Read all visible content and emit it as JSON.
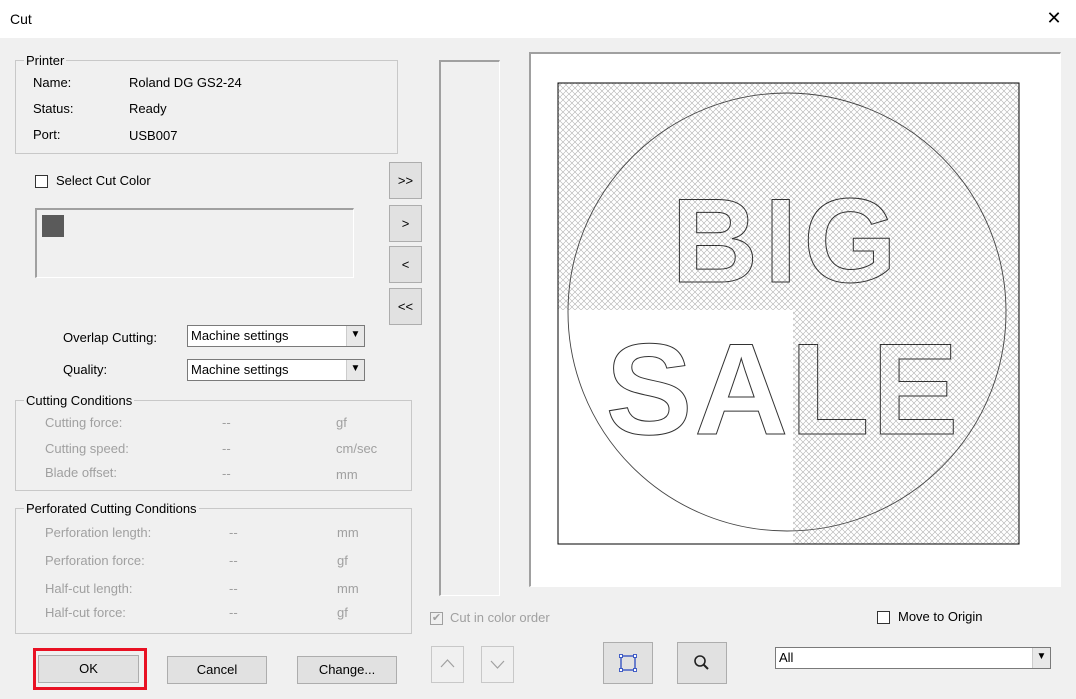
{
  "window": {
    "title": "Cut",
    "close": "✕"
  },
  "printer": {
    "legend": "Printer",
    "name_label": "Name:",
    "name_value": "Roland DG GS2-24",
    "status_label": "Status:",
    "status_value": "Ready",
    "port_label": "Port:",
    "port_value": "USB007"
  },
  "select_cut_color": {
    "label": "Select Cut Color",
    "checked": false,
    "swatch_color": "#5a5a5a"
  },
  "transfer_buttons": [
    ">>",
    ">",
    "<",
    "<<"
  ],
  "overlap_cutting": {
    "label": "Overlap Cutting:",
    "value": "Machine settings"
  },
  "quality": {
    "label": "Quality:",
    "value": "Machine settings"
  },
  "cutting_conditions": {
    "legend": "Cutting Conditions",
    "rows": [
      {
        "label": "Cutting force:",
        "value": "--",
        "unit": "gf"
      },
      {
        "label": "Cutting speed:",
        "value": "--",
        "unit": "cm/sec"
      },
      {
        "label": "Blade offset:",
        "value": "--",
        "unit": "mm"
      }
    ]
  },
  "perforated_conditions": {
    "legend": "Perforated Cutting Conditions",
    "rows": [
      {
        "label": "Perforation length:",
        "value": "--",
        "unit": "mm"
      },
      {
        "label": "Perforation  force:",
        "value": "--",
        "unit": "gf"
      },
      {
        "label": "Half-cut length:",
        "value": "--",
        "unit": "mm"
      },
      {
        "label": "Half-cut force:",
        "value": "--",
        "unit": "gf"
      }
    ]
  },
  "cut_in_color_order": {
    "label": "Cut in color order",
    "checked": true
  },
  "move_to_origin": {
    "label": "Move to Origin",
    "checked": false
  },
  "view_select": {
    "value": "All"
  },
  "buttons": {
    "ok": "OK",
    "cancel": "Cancel",
    "change": "Change..."
  },
  "preview": {
    "line1": "BIG",
    "line2": "SALE"
  },
  "colors": {
    "highlight": "#e81123",
    "swatch": "#5a5a5a"
  }
}
